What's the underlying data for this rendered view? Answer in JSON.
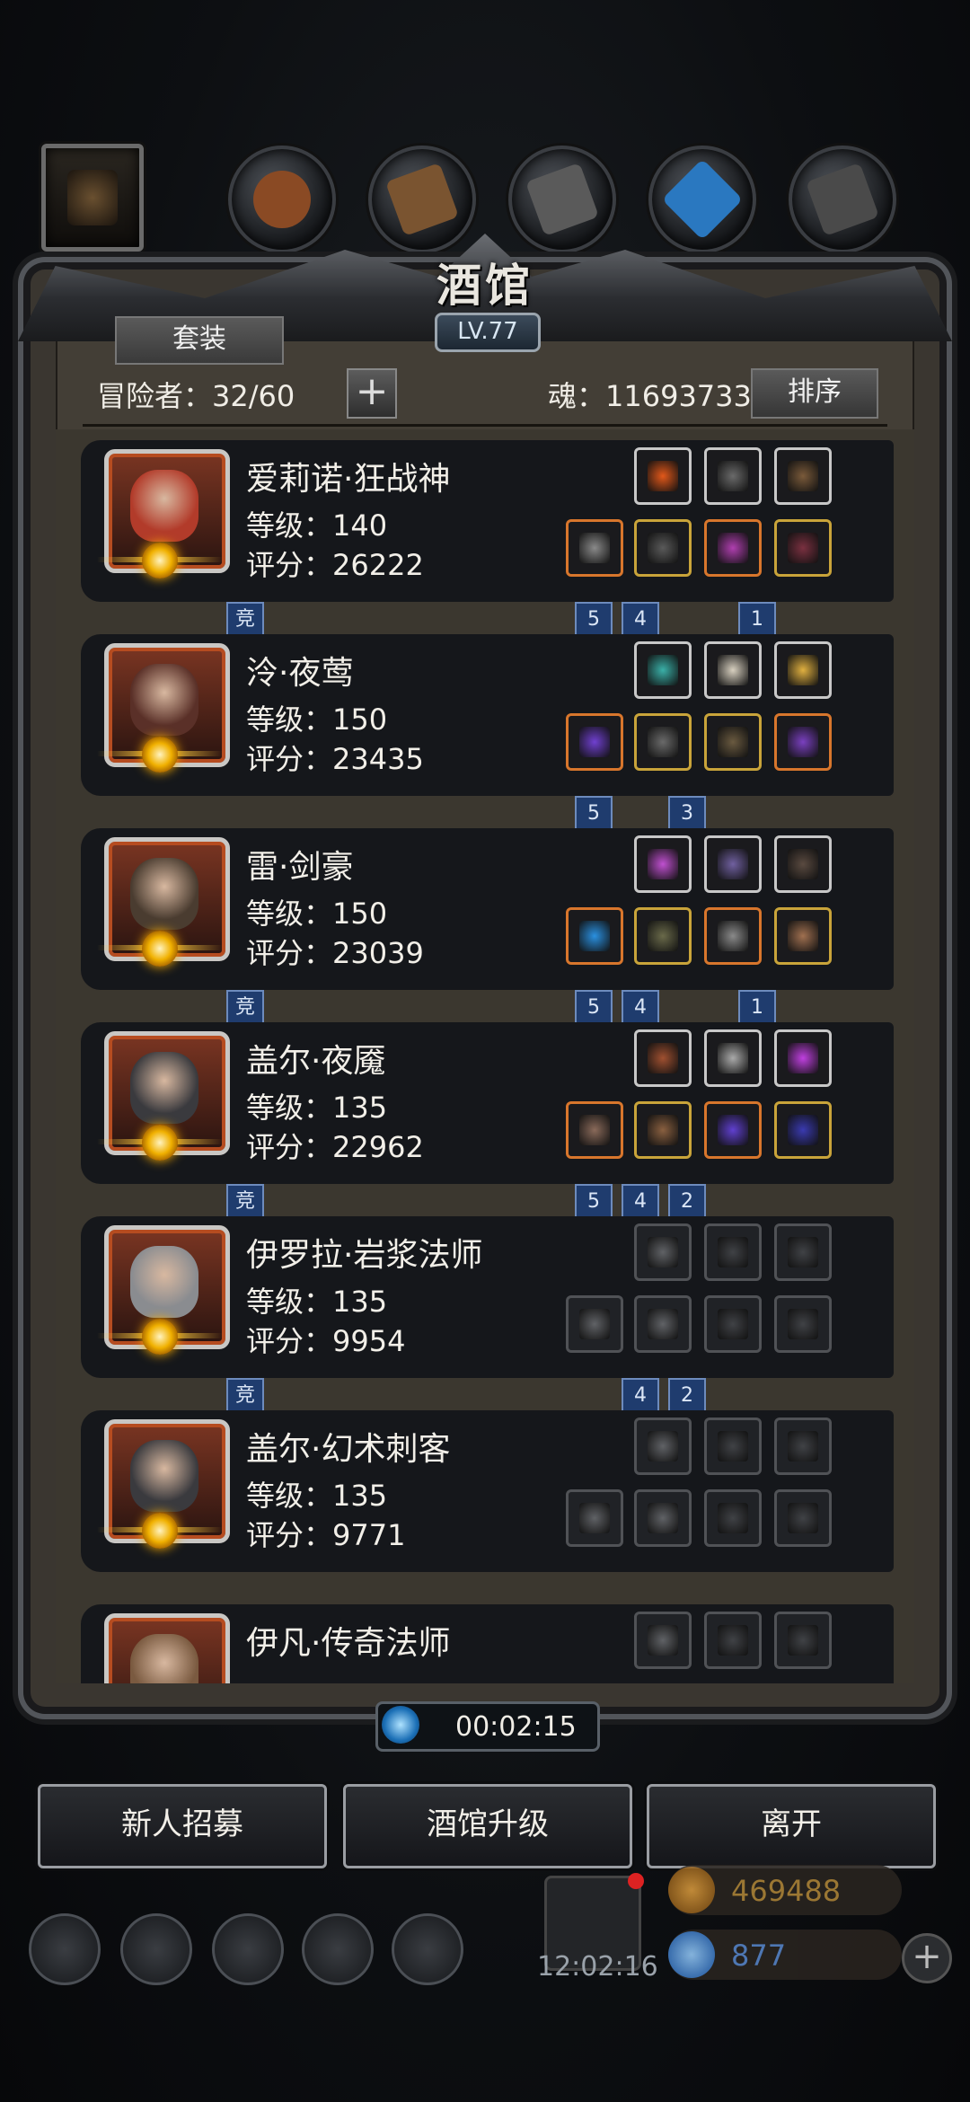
{
  "header": {
    "title": "酒馆",
    "level": "LV.77"
  },
  "toolbar": {
    "suit_label": "套装",
    "plus_label": "+",
    "sort_label": "排序"
  },
  "stats": {
    "adventurers": "冒险者：32/60",
    "soul": "魂：11693733"
  },
  "heroes": [
    {
      "name": "爱莉诺·狂战神",
      "level": "等级：140",
      "score": "评分：26222",
      "badge": "竞",
      "ranks": [
        "5",
        "4",
        "",
        "1"
      ],
      "face": "#b23b2a",
      "top": [
        "#e2581a",
        "#6a6a6a",
        "#7a5a3a"
      ],
      "bottom": [
        "#8a8a8a",
        "#5a5a5a",
        "#b03fb0",
        "#7a3040"
      ],
      "top_border": [
        "white",
        "white",
        "white"
      ],
      "bottom_border": [
        "orange",
        "gold",
        "orange",
        "gold"
      ]
    },
    {
      "name": "泠·夜莺",
      "level": "等级：150",
      "score": "评分：23435",
      "badge": "",
      "ranks": [
        "5",
        "",
        "3",
        ""
      ],
      "face": "#5a3028",
      "top": [
        "#3ab0a8",
        "#d8d0c0",
        "#e0b040"
      ],
      "bottom": [
        "#7040d0",
        "#6a6a6a",
        "#6a5a40",
        "#7a40c0"
      ],
      "top_border": [
        "white",
        "white",
        "white"
      ],
      "bottom_border": [
        "orange",
        "gold",
        "gold",
        "orange"
      ]
    },
    {
      "name": "雷·剑豪",
      "level": "等级：150",
      "score": "评分：23039",
      "badge": "竞",
      "ranks": [
        "5",
        "4",
        "",
        "1"
      ],
      "face": "#4a3c30",
      "top": [
        "#c050d0",
        "#7060a0",
        "#5a4a40"
      ],
      "bottom": [
        "#2a90e0",
        "#6a6a4a",
        "#8a8a8a",
        "#a07050"
      ],
      "top_border": [
        "white",
        "white",
        "white"
      ],
      "bottom_border": [
        "orange",
        "gold",
        "orange",
        "gold"
      ]
    },
    {
      "name": "盖尔·夜魇",
      "level": "等级：135",
      "score": "评分：22962",
      "badge": "竞",
      "ranks": [
        "5",
        "4",
        "2",
        ""
      ],
      "face": "#3a3a3e",
      "top": [
        "#a05030",
        "#aaaaaa",
        "#c040e0"
      ],
      "bottom": [
        "#8a6a5a",
        "#8a6040",
        "#6040d0",
        "#3a3ab0"
      ],
      "top_border": [
        "white",
        "white",
        "white"
      ],
      "bottom_border": [
        "orange",
        "gold",
        "orange",
        "gold"
      ]
    },
    {
      "name": "伊罗拉·岩浆法师",
      "level": "等级：135",
      "score": "评分：9954",
      "badge": "竞",
      "ranks": [
        "",
        "4",
        "2",
        ""
      ],
      "face": "#8a8c90",
      "top": [
        "#606266",
        "#404246",
        "#404246"
      ],
      "bottom": [
        "#606266",
        "#606266",
        "#404246",
        "#404246"
      ],
      "top_border": [
        "empty",
        "empty",
        "empty"
      ],
      "bottom_border": [
        "empty",
        "empty",
        "empty",
        "empty"
      ]
    },
    {
      "name": "盖尔·幻术刺客",
      "level": "等级：135",
      "score": "评分：9771",
      "badge": "",
      "ranks": [
        "",
        "",
        "",
        ""
      ],
      "face": "#3a3a3e",
      "top": [
        "#606266",
        "#404246",
        "#404246"
      ],
      "bottom": [
        "#606266",
        "#606266",
        "#404246",
        "#404246"
      ],
      "top_border": [
        "empty",
        "empty",
        "empty"
      ],
      "bottom_border": [
        "empty",
        "empty",
        "empty",
        "empty"
      ]
    },
    {
      "name": "伊凡·传奇法师",
      "level": "",
      "score": "",
      "badge": "",
      "ranks": [
        "",
        "",
        "",
        ""
      ],
      "face": "#7a5a40",
      "top": [
        "#606266",
        "#404246",
        "#404246"
      ],
      "bottom": [],
      "top_border": [
        "empty",
        "empty",
        "empty"
      ],
      "bottom_border": []
    }
  ],
  "timer": "00:02:15",
  "buttons": {
    "recruit": "新人招募",
    "upgrade": "酒馆升级",
    "leave": "离开"
  },
  "bottom": {
    "clock": "12:02:16",
    "gold": "469488",
    "gems": "877"
  },
  "colors": {
    "accent_gold": "#f3c23c",
    "rank_flag": "#1f3c6e"
  }
}
